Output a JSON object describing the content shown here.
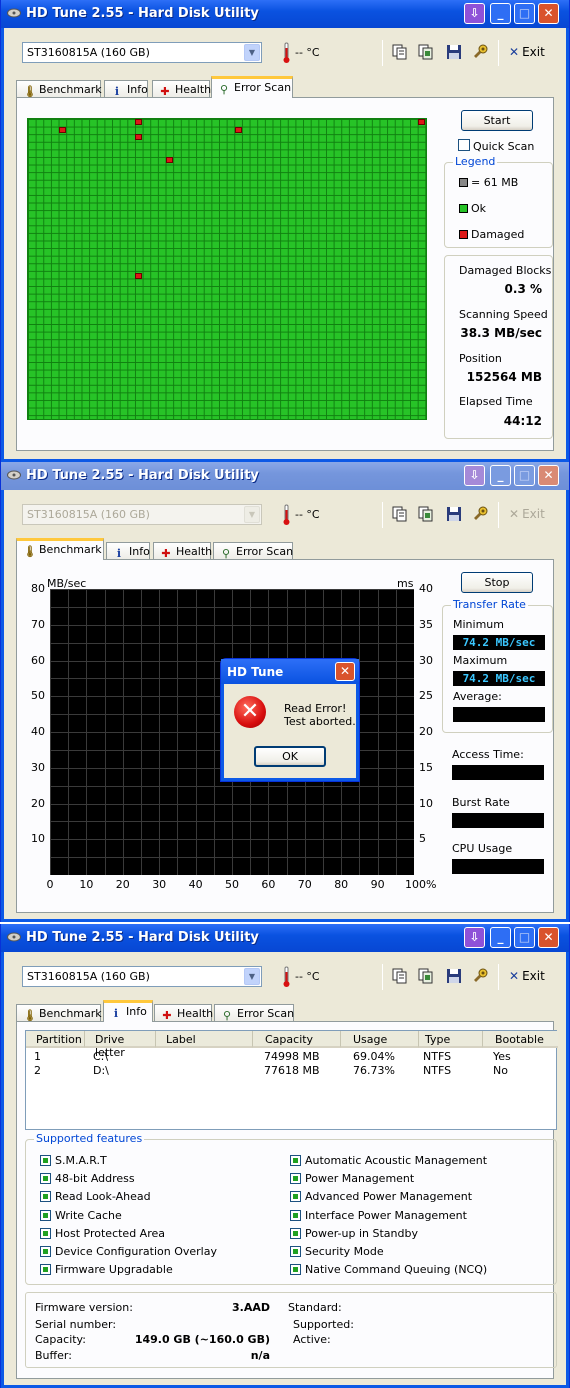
{
  "windows": [
    {
      "title": "HD Tune 2.55 - Hard Disk Utility",
      "drive": "ST3160815A (160 GB)",
      "temperature": "-- °C",
      "exit_label": "Exit",
      "tabs": [
        "Benchmark",
        "Info",
        "Health",
        "Error Scan"
      ],
      "active_tab": "Error Scan",
      "start_label": "Start",
      "quick_scan_label": "Quick Scan",
      "quick_scan_checked": false,
      "legend": {
        "title": "Legend",
        "block_size": "= 61 MB",
        "ok": "Ok",
        "damaged": "Damaged"
      },
      "stats": {
        "damaged_blocks_label": "Damaged Blocks",
        "damaged_blocks_value": "0.3 %",
        "scanning_speed_label": "Scanning Speed",
        "scanning_speed_value": "38.3 MB/sec",
        "position_label": "Position",
        "position_value": "152564 MB",
        "elapsed_label": "Elapsed Time",
        "elapsed_value": "44:12"
      },
      "scan_grid": {
        "columns": 52,
        "rows": 39,
        "damaged_cells": [
          [
            0,
            14
          ],
          [
            0,
            51
          ],
          [
            1,
            27
          ],
          [
            1,
            4
          ],
          [
            2,
            14
          ],
          [
            5,
            18
          ],
          [
            20,
            14
          ]
        ]
      }
    },
    {
      "title": "HD Tune 2.55 - Hard Disk Utility",
      "drive": "ST3160815A (160 GB)",
      "temperature": "-- °C",
      "exit_label": "Exit",
      "tabs": [
        "Benchmark",
        "Info",
        "Health",
        "Error Scan"
      ],
      "active_tab": "Benchmark",
      "stop_label": "Stop",
      "chart": {
        "y_left_unit": "MB/sec",
        "y_right_unit": "ms",
        "y_left_ticks": [
          "80",
          "70",
          "60",
          "50",
          "40",
          "30",
          "20",
          "10"
        ],
        "y_right_ticks": [
          "40",
          "35",
          "30",
          "25",
          "20",
          "15",
          "10",
          "5"
        ],
        "x_ticks": [
          "0",
          "10",
          "20",
          "30",
          "40",
          "50",
          "60",
          "70",
          "80",
          "90",
          "100%"
        ]
      },
      "transfer_rate": {
        "title": "Transfer Rate",
        "minimum_label": "Minimum",
        "minimum_value": "74.2 MB/sec",
        "maximum_label": "Maximum",
        "maximum_value": "74.2 MB/sec",
        "average_label": "Average:",
        "average_value": ""
      },
      "access_time_label": "Access Time:",
      "burst_rate_label": "Burst Rate",
      "cpu_usage_label": "CPU Usage",
      "dialog": {
        "title": "HD Tune",
        "message_line1": "Read Error!",
        "message_line2": "Test aborted.",
        "ok_label": "OK"
      }
    },
    {
      "title": "HD Tune 2.55 - Hard Disk Utility",
      "drive": "ST3160815A (160 GB)",
      "temperature": "-- °C",
      "exit_label": "Exit",
      "tabs": [
        "Benchmark",
        "Info",
        "Health",
        "Error Scan"
      ],
      "active_tab": "Info",
      "partition_table": {
        "headers": [
          "Partition",
          "Drive letter",
          "Label",
          "Capacity",
          "Usage",
          "Type",
          "Bootable"
        ],
        "rows": [
          [
            "1",
            "C:\\",
            "",
            "74998 MB",
            "69.04%",
            "NTFS",
            "Yes"
          ],
          [
            "2",
            "D:\\",
            "",
            "77618 MB",
            "76.73%",
            "NTFS",
            "No"
          ]
        ]
      },
      "supported_features": {
        "title": "Supported features",
        "left": [
          "S.M.A.R.T",
          "48-bit Address",
          "Read Look-Ahead",
          "Write Cache",
          "Host Protected Area",
          "Device Configuration Overlay",
          "Firmware Upgradable"
        ],
        "right": [
          "Automatic Acoustic Management",
          "Power Management",
          "Advanced Power Management",
          "Interface Power Management",
          "Power-up in Standby",
          "Security Mode",
          "Native Command Queuing (NCQ)"
        ]
      },
      "info": {
        "firmware_label": "Firmware version:",
        "firmware_value": "3.AAD",
        "serial_label": "Serial number:",
        "serial_value": "",
        "capacity_label": "Capacity:",
        "capacity_value": "149.0 GB (~160.0 GB)",
        "buffer_label": "Buffer:",
        "buffer_value": "n/a",
        "standard_label": "Standard:",
        "supported_label": "Supported:",
        "active_label": "Active:"
      }
    }
  ]
}
